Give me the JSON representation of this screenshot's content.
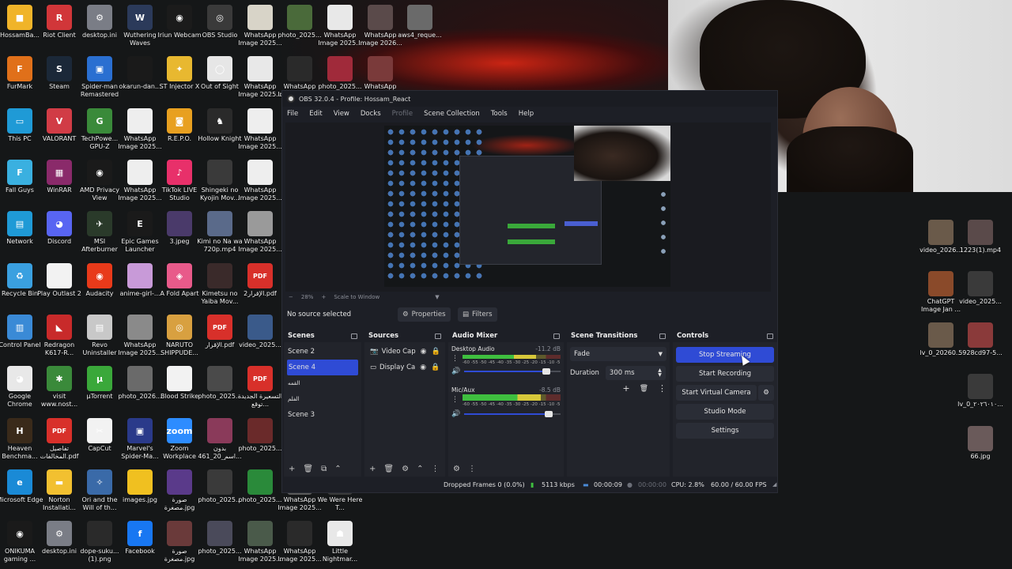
{
  "desktop": {
    "icons": [
      {
        "label": "HossamBa...",
        "color": "#f0b429",
        "glyph": "■"
      },
      {
        "label": "Riot Client",
        "color": "#d13639",
        "glyph": "R"
      },
      {
        "label": "desktop.ini",
        "color": "#7a7d86",
        "glyph": "⚙"
      },
      {
        "label": "Wuthering Waves",
        "color": "#2b3a5a",
        "glyph": "W"
      },
      {
        "label": "Iriun Webcam",
        "color": "#1b1b1b",
        "glyph": "◉"
      },
      {
        "label": "OBS Studio",
        "color": "#3a3a3a",
        "glyph": "◎"
      },
      {
        "label": "WhatsApp Image 2025...",
        "color": "#d8d4c8",
        "glyph": ""
      },
      {
        "label": "photo_2025...",
        "color": "#4a6a3a",
        "glyph": ""
      },
      {
        "label": "WhatsApp Image 2025...",
        "color": "#e8e8e8",
        "glyph": ""
      },
      {
        "label": "WhatsApp Image 2026...",
        "color": "#5a4a4a",
        "glyph": ""
      },
      {
        "label": "aws4_reque...",
        "color": "#6a6a6a",
        "glyph": ""
      },
      {
        "label": "FurMark",
        "color": "#e0701a",
        "glyph": "F"
      },
      {
        "label": "Steam",
        "color": "#1b2838",
        "glyph": "S"
      },
      {
        "label": "Spider-man Remastered",
        "color": "#2a6fd1",
        "glyph": "▣"
      },
      {
        "label": "okarun-dan...",
        "color": "#1a1a1a",
        "glyph": ""
      },
      {
        "label": "ST Injector X",
        "color": "#e8b830",
        "glyph": "✦"
      },
      {
        "label": "Out of Sight",
        "color": "#e6e6e6",
        "glyph": "◯"
      },
      {
        "label": "WhatsApp Image 2025...",
        "color": "#e8e8e8",
        "glyph": ""
      },
      {
        "label": "WhatsApp Image 2025...",
        "color": "#2a2a2a",
        "glyph": ""
      },
      {
        "label": "photo_2025...",
        "color": "#a02a3a",
        "glyph": ""
      },
      {
        "label": "WhatsApp Image 2025...",
        "color": "#7a3a3a",
        "glyph": ""
      },
      {
        "label": "This PC",
        "color": "#1f9ad6",
        "glyph": "▭"
      },
      {
        "label": "VALORANT",
        "color": "#d13c46",
        "glyph": "V"
      },
      {
        "label": "TechPowe... GPU-Z",
        "color": "#3a8a3a",
        "glyph": "G"
      },
      {
        "label": "WhatsApp Image 2025...",
        "color": "#eeeeee",
        "glyph": ""
      },
      {
        "label": "R.E.P.O.",
        "color": "#e8a020",
        "glyph": "◙"
      },
      {
        "label": "Hollow Knight",
        "color": "#2a2a2a",
        "glyph": "♞"
      },
      {
        "label": "WhatsApp Image 2025...",
        "color": "#eeeeee",
        "glyph": ""
      },
      {
        "label": "Fall Guys",
        "color": "#3ab0e0",
        "glyph": "F"
      },
      {
        "label": "WinRAR",
        "color": "#8a2a6a",
        "glyph": "▦"
      },
      {
        "label": "AMD Privacy View",
        "color": "#1a1a1a",
        "glyph": "◉"
      },
      {
        "label": "WhatsApp Image 2025...",
        "color": "#eeeeee",
        "glyph": ""
      },
      {
        "label": "TikTok LIVE Studio",
        "color": "#e8306a",
        "glyph": "♪"
      },
      {
        "label": "Shingeki no Kyojin Mov...",
        "color": "#3a3a3a",
        "glyph": ""
      },
      {
        "label": "WhatsApp Image 2025...",
        "color": "#eeeeee",
        "glyph": ""
      },
      {
        "label": "Network",
        "color": "#1f9ad6",
        "glyph": "▤"
      },
      {
        "label": "Discord",
        "color": "#5865f2",
        "glyph": "◕"
      },
      {
        "label": "MSI Afterburner",
        "color": "#2a3a2a",
        "glyph": "✈"
      },
      {
        "label": "Epic Games Launcher",
        "color": "#1a1a1a",
        "glyph": "E"
      },
      {
        "label": "3.jpeg",
        "color": "#4a3a6a",
        "glyph": ""
      },
      {
        "label": "Kimi no Na wa 720p.mp4",
        "color": "#5a6a8a",
        "glyph": ""
      },
      {
        "label": "WhatsApp Image 2025...",
        "color": "#9a9a9a",
        "glyph": ""
      },
      {
        "label": "Recycle Bin",
        "color": "#3aa0e0",
        "glyph": "♻"
      },
      {
        "label": "Play Outlast 2",
        "color": "#f2f2f2",
        "glyph": ""
      },
      {
        "label": "Audacity",
        "color": "#e83a1a",
        "glyph": "◉"
      },
      {
        "label": "anime-girl-...",
        "color": "#c89ad8",
        "glyph": ""
      },
      {
        "label": "A Fold Apart",
        "color": "#e85a8a",
        "glyph": "◈"
      },
      {
        "label": "Kimetsu no Yaiba Mov...",
        "color": "#3a2a2a",
        "glyph": ""
      },
      {
        "label": "الإقرار2.pdf",
        "color": "#d8302a",
        "glyph": "PDF"
      },
      {
        "label": "Control Panel",
        "color": "#3a8ad6",
        "glyph": "▥"
      },
      {
        "label": "Redragon K617-R...",
        "color": "#c82a2a",
        "glyph": "◣"
      },
      {
        "label": "Revo Uninstaller",
        "color": "#c8c8c8",
        "glyph": "▤"
      },
      {
        "label": "WhatsApp Image 2025...",
        "color": "#8a8a8a",
        "glyph": ""
      },
      {
        "label": "NARUTO SHIPPUDE...",
        "color": "#d8a040",
        "glyph": "◎"
      },
      {
        "label": "الإقرار.pdf",
        "color": "#d8302a",
        "glyph": "PDF"
      },
      {
        "label": "video_2025...",
        "color": "#3a5a8a",
        "glyph": ""
      },
      {
        "label": "Google Chrome",
        "color": "#e8e8e8",
        "glyph": "◕"
      },
      {
        "label": "visit www.nost...",
        "color": "#3a8a3a",
        "glyph": "✱"
      },
      {
        "label": "µTorrent",
        "color": "#3aa83a",
        "glyph": "µ"
      },
      {
        "label": "photo_2026...",
        "color": "#6a6a6a",
        "glyph": ""
      },
      {
        "label": "Blood Strike",
        "color": "#f2f2f2",
        "glyph": ""
      },
      {
        "label": "photo_2025...",
        "color": "#4a4a4a",
        "glyph": ""
      },
      {
        "label": "التسعيرة الجديدة توقع...",
        "color": "#d8302a",
        "glyph": "PDF"
      },
      {
        "label": "Heaven Benchma...",
        "color": "#3a2a1a",
        "glyph": "H"
      },
      {
        "label": "تفاصيل المخالفات.pdf",
        "color": "#d8302a",
        "glyph": "PDF"
      },
      {
        "label": "CapCut",
        "color": "#f2f2f2",
        "glyph": "✂"
      },
      {
        "label": "Marvel's Spider-Ma...",
        "color": "#2a3a8a",
        "glyph": "▣"
      },
      {
        "label": "Zoom Workplace",
        "color": "#2d8cff",
        "glyph": "zoom"
      },
      {
        "label": "بدون اسم_20_461...",
        "color": "#8a3a5a",
        "glyph": ""
      },
      {
        "label": "photo_2025...",
        "color": "#6a2a2a",
        "glyph": ""
      },
      {
        "label": "Microsoft Edge",
        "color": "#1a8ad6",
        "glyph": "e"
      },
      {
        "label": "Norton Installati...",
        "color": "#f2c030",
        "glyph": "▬"
      },
      {
        "label": "Ori and the Will of th...",
        "color": "#3a6aa8",
        "glyph": "✧"
      },
      {
        "label": "images.jpg",
        "color": "#f0c020",
        "glyph": ""
      },
      {
        "label": "صورة مصغرة.jpg",
        "color": "#5a3a8a",
        "glyph": ""
      },
      {
        "label": "photo_2025...",
        "color": "#3a3a3a",
        "glyph": ""
      },
      {
        "label": "photo_2025...",
        "color": "#2a8a3a",
        "glyph": ""
      },
      {
        "label": "WhatsApp Image 2025...",
        "color": "#5a5a5a",
        "glyph": ""
      },
      {
        "label": "We Were Here T...",
        "color": "#3a3a3a",
        "glyph": ""
      },
      {
        "label": "ONIKUMA gaming ...",
        "color": "#1a1a1a",
        "glyph": "◉"
      },
      {
        "label": "desktop.ini",
        "color": "#7a7d86",
        "glyph": "⚙"
      },
      {
        "label": "dope-suku... (1).png",
        "color": "#2a2a2a",
        "glyph": ""
      },
      {
        "label": "Facebook",
        "color": "#1877f2",
        "glyph": "f"
      },
      {
        "label": "صورة مصغرة.jpg",
        "color": "#6a3a3a",
        "glyph": ""
      },
      {
        "label": "photo_2025...",
        "color": "#4a4a5a",
        "glyph": ""
      },
      {
        "label": "WhatsApp Image 2025...",
        "color": "#4a5a4a",
        "glyph": ""
      },
      {
        "label": "WhatsApp Image 2025...",
        "color": "#2a2a2a",
        "glyph": ""
      },
      {
        "label": "Little Nightmar...",
        "color": "#e8e8e8",
        "glyph": "☗"
      },
      {
        "label": "video_2026...",
        "color": "#6a5a4a",
        "glyph": ""
      },
      {
        "label": "1223(1).mp4",
        "color": "#5a4a4a",
        "glyph": ""
      },
      {
        "label": "ChatGPT Image Jan ...",
        "color": "#8a4a2a",
        "glyph": ""
      },
      {
        "label": "video_2025...",
        "color": "#3a3a3a",
        "glyph": ""
      },
      {
        "label": "lv_0_20260...",
        "color": "#6a5a4a",
        "glyph": ""
      },
      {
        "label": "5928cd97-5...",
        "color": "#8a3a3a",
        "glyph": ""
      },
      {
        "label": "lv_0_٢٠٢٦٠١٠...",
        "color": "#3a3a3a",
        "glyph": ""
      },
      {
        "label": "66.jpg",
        "color": "#6a5a5a",
        "glyph": ""
      }
    ]
  },
  "obs": {
    "title": "OBS 32.0.4 - Profile: Hossam_React",
    "menu": [
      "File",
      "Edit",
      "View",
      "Docks",
      "Profile",
      "Scene Collection",
      "Tools",
      "Help"
    ],
    "zoom": {
      "minus": "−",
      "level": "28%",
      "plus": "+",
      "mode": "Scale to Window",
      "caret": "▼"
    },
    "source_bar": {
      "status": "No source selected",
      "properties": "Properties",
      "filters": "Filters"
    },
    "scenes": {
      "title": "Scenes",
      "items": [
        {
          "label": "Scene 2",
          "selected": false
        },
        {
          "label": "Scene 4",
          "selected": true
        },
        {
          "label": "القمه",
          "selected": false
        },
        {
          "label": "الفلم",
          "selected": false
        },
        {
          "label": "Scene 3",
          "selected": false
        }
      ]
    },
    "sources": {
      "title": "Sources",
      "items": [
        {
          "label": "Video Cap",
          "icon": "camera-icon"
        },
        {
          "label": "Display Ca",
          "icon": "display-icon"
        }
      ]
    },
    "mixer": {
      "title": "Audio Mixer",
      "channels": [
        {
          "name": "Desktop Audio",
          "db": "-11.2 dB",
          "level": 0.75,
          "volume": 0.85
        },
        {
          "name": "Mic/Aux",
          "db": "-8.5 dB",
          "level": 0.8,
          "volume": 0.88
        }
      ],
      "ticks": "-60 -55 -50 -45 -40 -35 -30 -25 -20 -15 -10 -5 0"
    },
    "transitions": {
      "title": "Scene Transitions",
      "type": "Fade",
      "duration_label": "Duration",
      "duration": "300 ms"
    },
    "controls": {
      "title": "Controls",
      "stop_streaming": "Stop Streaming",
      "start_recording": "Start Recording",
      "start_virtual_camera": "Start Virtual Camera",
      "studio_mode": "Studio Mode",
      "settings": "Settings"
    },
    "status": {
      "dropped_frames": "Dropped Frames 0 (0.0%)",
      "bitrate": "5113 kbps",
      "stream_time": "00:00:09",
      "record_time": "00:00:00",
      "cpu": "CPU: 2.8%",
      "fps": "60.00 / 60.00 FPS"
    },
    "colors": {
      "accent": "#2f4bd5",
      "panel": "#22242b",
      "window": "#1d1f26"
    }
  }
}
